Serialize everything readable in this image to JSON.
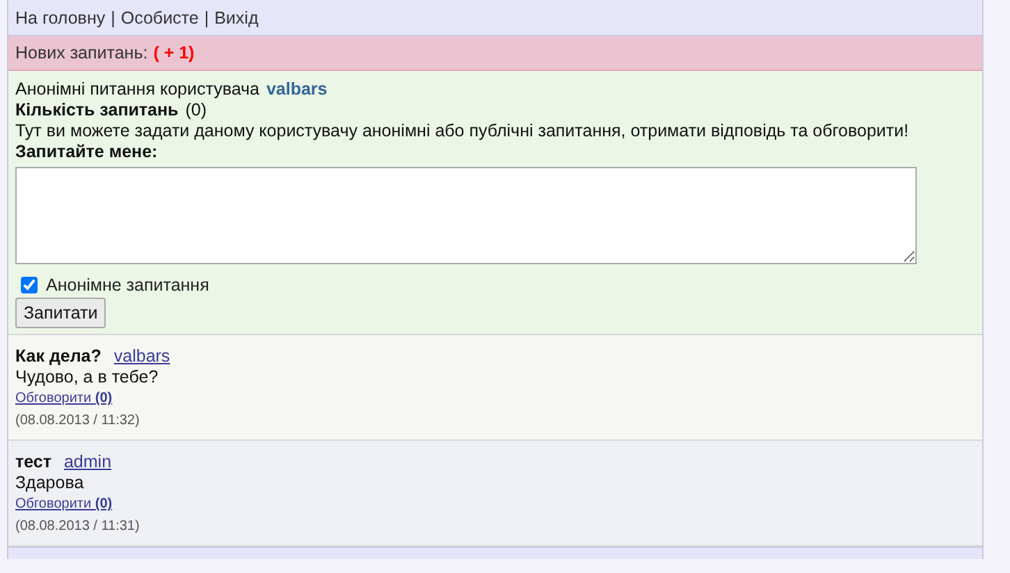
{
  "nav": {
    "links": [
      "На головну",
      "Особисте",
      "Вихід"
    ],
    "separator": "|"
  },
  "notice": {
    "label": "Нових запитань:",
    "count": "( + 1)"
  },
  "ask": {
    "intro": "Анонімні питання користувача",
    "user": "valbars",
    "count_label": "Кількість запитань",
    "count": "(0)",
    "description": "Тут ви можете задати даному користувачу анонімні або публічні запитання, отримати відповідь та обговорити!",
    "prompt": "Запитайте мене:",
    "anonymous": {
      "label": "Анонімне запитання",
      "checked": true
    },
    "button": "Запитати"
  },
  "questions": [
    {
      "question": "Как дела?",
      "author": "valbars",
      "answer": "Чудово, а в тебе?",
      "discuss": "Обговорити **(0)**",
      "date": "(08.08.2013 / 11:32)"
    },
    {
      "question": "тест",
      "author": "admin",
      "answer": "Здарова",
      "discuss": "Обговорити **(0)**",
      "date": "(08.08.2013 / 11:31)"
    }
  ]
}
